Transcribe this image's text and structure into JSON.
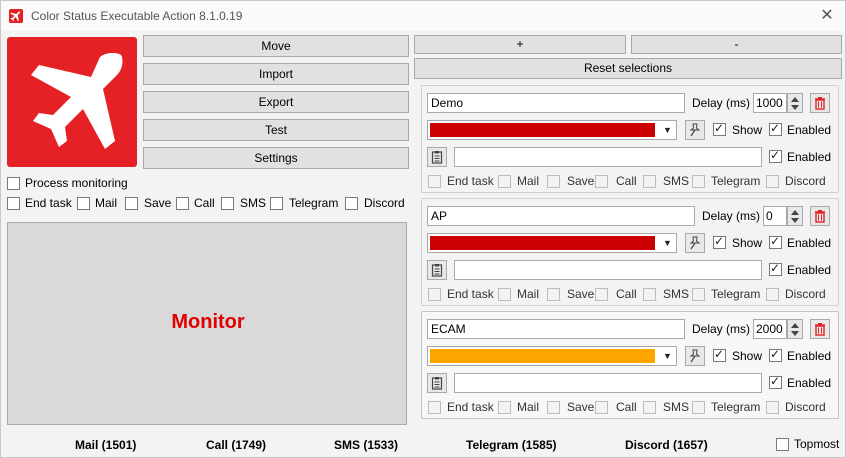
{
  "window": {
    "title": "Color Status Executable Action 8.1.0.19",
    "close_glyph": "✕"
  },
  "left_buttons": {
    "move": "Move",
    "import": "Import",
    "export": "Export",
    "test": "Test",
    "settings": "Settings"
  },
  "process_monitoring": {
    "label": "Process monitoring",
    "checked": false
  },
  "left_actions": [
    "End task",
    "Mail",
    "Save",
    "Call",
    "SMS",
    "Telegram",
    "Discord"
  ],
  "monitor": {
    "text": "Monitor",
    "color": "#e00000"
  },
  "top_right": {
    "plus": "+",
    "minus": "-",
    "reset": "Reset selections"
  },
  "entries": [
    {
      "name": "Demo",
      "delay_label": "Delay (ms)",
      "delay": "1000",
      "color": "#cc0000",
      "show_label": "Show",
      "show": true,
      "enabled_label": "Enabled",
      "enabled": true,
      "command": "",
      "command_enabled_label": "Enabled",
      "command_enabled": true,
      "actions": [
        "End task",
        "Mail",
        "Save",
        "Call",
        "SMS",
        "Telegram",
        "Discord"
      ]
    },
    {
      "name": "AP",
      "delay_label": "Delay (ms)",
      "delay": "0",
      "color": "#cc0000",
      "show_label": "Show",
      "show": true,
      "enabled_label": "Enabled",
      "enabled": true,
      "command": "",
      "command_enabled_label": "Enabled",
      "command_enabled": true,
      "actions": [
        "End task",
        "Mail",
        "Save",
        "Call",
        "SMS",
        "Telegram",
        "Discord"
      ]
    },
    {
      "name": "ECAM",
      "delay_label": "Delay (ms)",
      "delay": "2000",
      "color": "#ffa500",
      "show_label": "Show",
      "show": true,
      "enabled_label": "Enabled",
      "enabled": true,
      "command": "",
      "command_enabled_label": "Enabled",
      "command_enabled": true,
      "actions": [
        "End task",
        "Mail",
        "Save",
        "Call",
        "SMS",
        "Telegram",
        "Discord"
      ]
    }
  ],
  "footer": {
    "mail": "Mail (1501)",
    "call": "Call (1749)",
    "sms": "SMS (1533)",
    "telegram": "Telegram (1585)",
    "discord": "Discord (1657)",
    "topmost_label": "Topmost",
    "topmost": false
  },
  "colors": {
    "brand_red": "#e52125"
  },
  "icons": {
    "app": "airplane-icon",
    "pin": "pin-icon",
    "delete": "trash-icon",
    "clipboard": "clipboard-icon"
  }
}
